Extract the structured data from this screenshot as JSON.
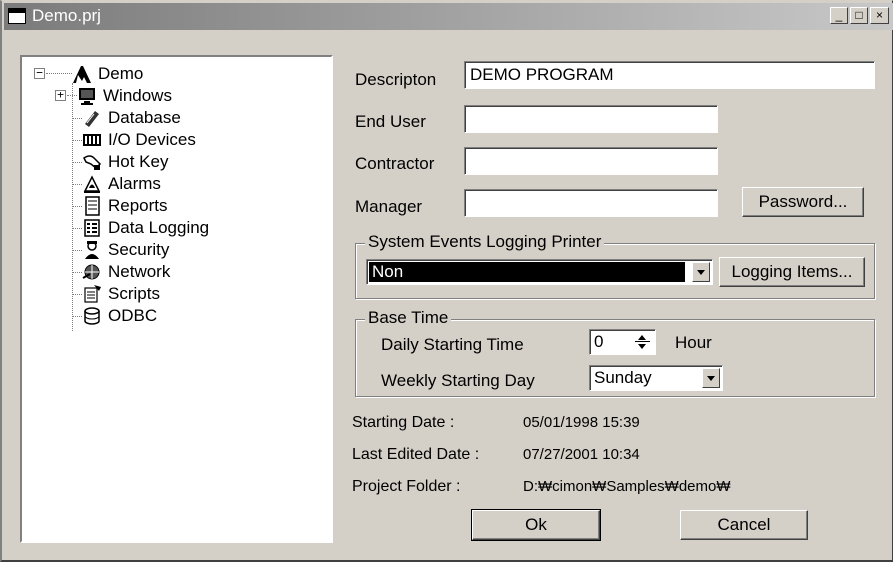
{
  "window": {
    "title": "Demo.prj",
    "min_glyph": "_",
    "max_glyph": "□",
    "close_glyph": "×"
  },
  "tree": {
    "root": {
      "label": "Demo",
      "icon": "cimon-logo-icon",
      "expander": "−"
    },
    "items": [
      {
        "label": "Windows",
        "icon": "monitor-icon",
        "expander": "+"
      },
      {
        "label": "Database",
        "icon": "database-icon"
      },
      {
        "label": "I/O Devices",
        "icon": "io-devices-icon"
      },
      {
        "label": "Hot Key",
        "icon": "hand-key-icon"
      },
      {
        "label": "Alarms",
        "icon": "alarm-bell-icon"
      },
      {
        "label": "Reports",
        "icon": "report-icon"
      },
      {
        "label": "Data Logging",
        "icon": "data-logging-icon"
      },
      {
        "label": "Security",
        "icon": "security-person-icon"
      },
      {
        "label": "Network",
        "icon": "network-icon"
      },
      {
        "label": "Scripts",
        "icon": "scripts-icon"
      },
      {
        "label": "ODBC",
        "icon": "odbc-cylinder-icon"
      }
    ]
  },
  "form": {
    "description": {
      "label": "Descripton",
      "value": "DEMO PROGRAM"
    },
    "end_user": {
      "label": "End User",
      "value": ""
    },
    "contractor": {
      "label": "Contractor",
      "value": ""
    },
    "manager": {
      "label": "Manager",
      "value": ""
    },
    "password_button": "Password...",
    "events_group": {
      "title": "System Events Logging Printer",
      "printer_value": "Non",
      "logging_items_button": "Logging Items..."
    },
    "base_time": {
      "title": "Base Time",
      "daily_label": "Daily Starting Time",
      "daily_value": "0",
      "daily_unit": "Hour",
      "weekly_label": "Weekly Starting Day",
      "weekly_value": "Sunday"
    },
    "info": {
      "starting_date_label": "Starting Date :",
      "starting_date_value": "05/01/1998  15:39",
      "last_edited_label": "Last Edited Date :",
      "last_edited_value": "07/27/2001  10:34",
      "project_folder_label": "Project Folder :",
      "project_folder_value": "D:₩cimon₩Samples₩demo₩"
    },
    "ok_button": "Ok",
    "cancel_button": "Cancel"
  },
  "colors": {
    "dialog_face": "#d4d0c8",
    "selection": "#000000"
  }
}
